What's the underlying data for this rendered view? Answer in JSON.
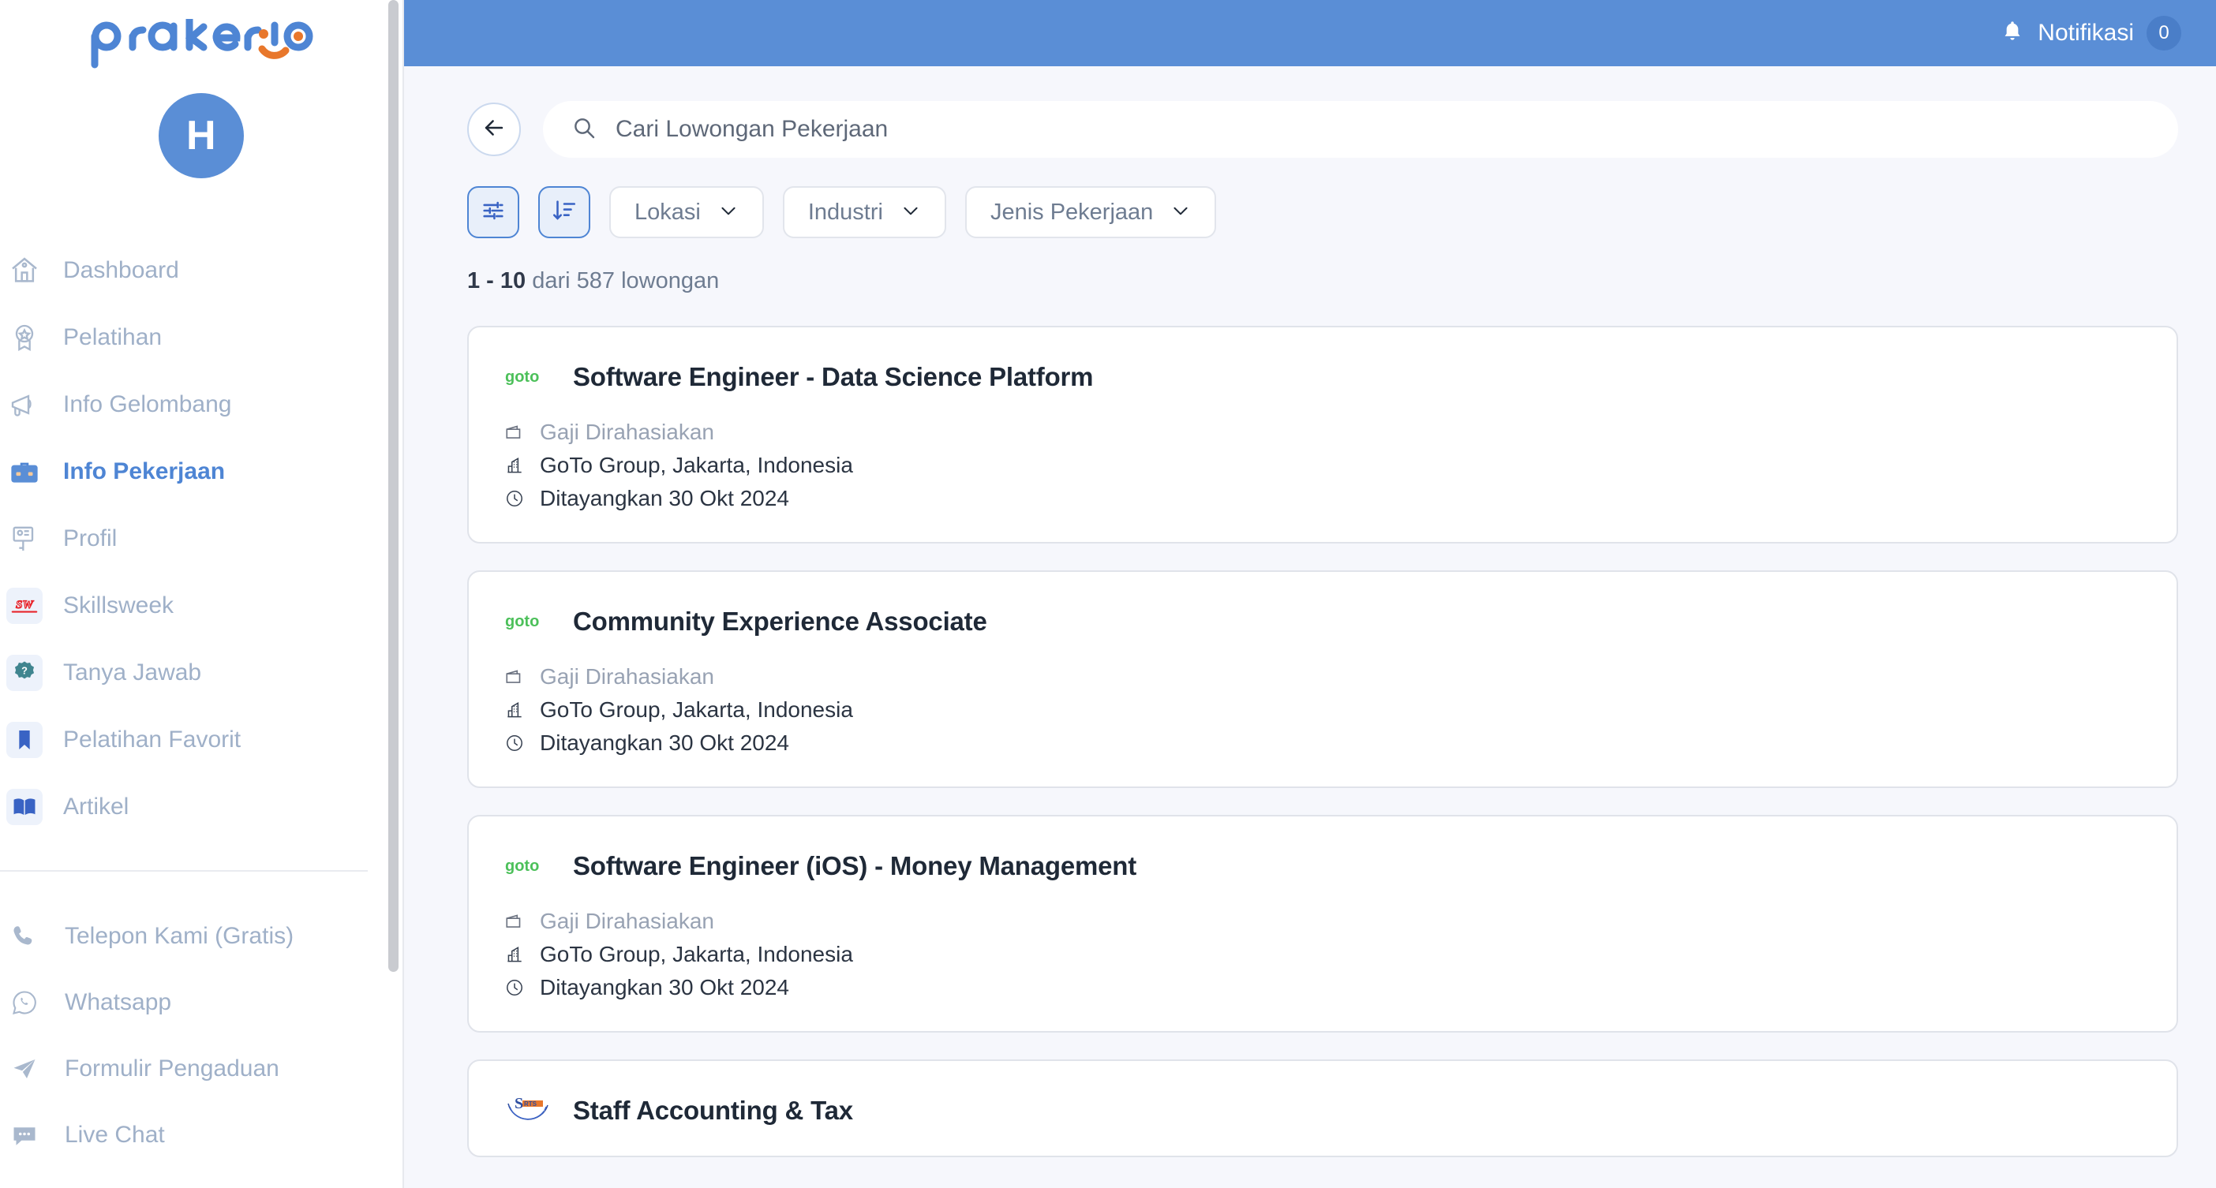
{
  "brand": {
    "name": "prakerja",
    "logo_blue": "#4E85D4",
    "logo_orange": "#E8772B"
  },
  "sidebar": {
    "avatar_initial": "H",
    "items": [
      {
        "label": "Dashboard",
        "icon": "home-icon",
        "active": false
      },
      {
        "label": "Pelatihan",
        "icon": "medal-icon",
        "active": false
      },
      {
        "label": "Info Gelombang",
        "icon": "megaphone-icon",
        "active": false
      },
      {
        "label": "Info Pekerjaan",
        "icon": "briefcase-icon",
        "active": true
      },
      {
        "label": "Profil",
        "icon": "profile-card-icon",
        "active": false
      },
      {
        "label": "Skillsweek",
        "icon": "skillsweek-icon",
        "active": false
      },
      {
        "label": "Tanya Jawab",
        "icon": "question-badge-icon",
        "active": false
      },
      {
        "label": "Pelatihan Favorit",
        "icon": "bookmark-icon",
        "active": false
      },
      {
        "label": "Artikel",
        "icon": "book-icon",
        "active": false
      }
    ],
    "support_items": [
      {
        "label": "Telepon Kami (Gratis)",
        "icon": "phone-icon"
      },
      {
        "label": "Whatsapp",
        "icon": "whatsapp-icon"
      },
      {
        "label": "Formulir Pengaduan",
        "icon": "paper-plane-icon"
      },
      {
        "label": "Live Chat",
        "icon": "chat-bubble-icon"
      }
    ]
  },
  "topbar": {
    "notification_label": "Notifikasi",
    "notification_count": "0",
    "bell_icon": "bell-icon",
    "background": "#5A8ED6"
  },
  "search": {
    "back_icon": "arrow-left-icon",
    "search_icon": "search-icon",
    "placeholder": "Cari Lowongan Pekerjaan",
    "value": ""
  },
  "filters": {
    "filter_icon": "sliders-icon",
    "sort_icon": "sort-descending-icon",
    "dropdowns": [
      {
        "label": "Lokasi",
        "chevron": "chevron-down-icon"
      },
      {
        "label": "Industri",
        "chevron": "chevron-down-icon"
      },
      {
        "label": "Jenis Pekerjaan",
        "chevron": "chevron-down-icon"
      }
    ]
  },
  "results": {
    "range": "1 - 10",
    "suffix": "dari 587 lowongan"
  },
  "jobs": [
    {
      "logo": "goto-logo",
      "title": "Software Engineer - Data Science Platform",
      "salary": "Gaji Dirahasiakan",
      "company": "GoTo Group, Jakarta, Indonesia",
      "posted": "Ditayangkan 30 Okt 2024",
      "salary_icon": "wallet-icon",
      "company_icon": "building-icon",
      "date_icon": "clock-icon"
    },
    {
      "logo": "goto-logo",
      "title": "Community Experience Associate",
      "salary": "Gaji Dirahasiakan",
      "company": "GoTo Group, Jakarta, Indonesia",
      "posted": "Ditayangkan 30 Okt 2024",
      "salary_icon": "wallet-icon",
      "company_icon": "building-icon",
      "date_icon": "clock-icon"
    },
    {
      "logo": "goto-logo",
      "title": "Software Engineer (iOS) - Money Management",
      "salary": "Gaji Dirahasiakan",
      "company": "GoTo Group, Jakarta, Indonesia",
      "posted": "Ditayangkan 30 Okt 2024",
      "salary_icon": "wallet-icon",
      "company_icon": "building-icon",
      "date_icon": "clock-icon"
    },
    {
      "logo": "srts-logo",
      "title": "Staff Accounting & Tax",
      "salary": "",
      "company": "",
      "posted": "",
      "salary_icon": "wallet-icon",
      "company_icon": "building-icon",
      "date_icon": "clock-icon"
    }
  ]
}
